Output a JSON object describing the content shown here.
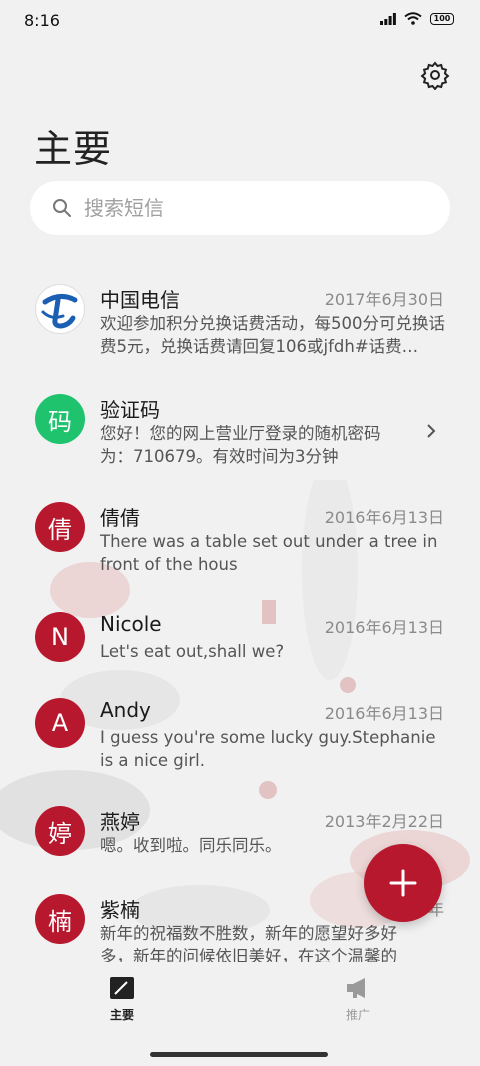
{
  "status_bar": {
    "time": "8:16",
    "battery": "100"
  },
  "header": {
    "title": "主要"
  },
  "search": {
    "placeholder": "搜索短信"
  },
  "messages": [
    {
      "sender": "中国电信",
      "date": "2017年6月30日",
      "preview": "欢迎参加积分兑换话费活动，每500分可兑换话费5元，兑换话费请回复106或jfdh#话费…",
      "avatar": "",
      "avatar_color": "#ffffff"
    },
    {
      "sender": "验证码",
      "date": "",
      "preview": "您好！您的网上营业厅登录的随机密码为：710679。有效时间为3分钟",
      "avatar": "码",
      "avatar_color": "#1fc36e"
    },
    {
      "sender": "倩倩",
      "date": "2016年6月13日",
      "preview": "There was a table set out under a tree in front of the hous",
      "avatar": "倩",
      "avatar_color": "#b8182e"
    },
    {
      "sender": "Nicole",
      "date": "2016年6月13日",
      "preview": "Let's eat out,shall we?",
      "avatar": "N",
      "avatar_color": "#b8182e"
    },
    {
      "sender": "Andy",
      "date": "2016年6月13日",
      "preview": "I guess you're some lucky guy.Stephanie is a nice girl.",
      "avatar": "A",
      "avatar_color": "#b8182e"
    },
    {
      "sender": "燕婷",
      "date": "2013年2月22日",
      "preview": "嗯。收到啦。同乐同乐。",
      "avatar": "婷",
      "avatar_color": "#b8182e"
    },
    {
      "sender": "紫楠",
      "date": "2013年",
      "preview": "新年的祝福数不胜数，新年的愿望好多好多，新年的问候依旧美好，在这个温馨的",
      "avatar": "楠",
      "avatar_color": "#b8182e"
    }
  ],
  "bottom_nav": {
    "tab_main": "主要",
    "tab_promo": "推广"
  },
  "colors": {
    "accent": "#b8182e",
    "verify_green": "#1fc36e",
    "background": "#f1f1f1"
  },
  "icons": {
    "settings": "gear-icon",
    "search": "search-icon",
    "compose": "plus-icon",
    "nav_main": "compose-note-icon",
    "nav_promo": "megaphone-icon"
  }
}
